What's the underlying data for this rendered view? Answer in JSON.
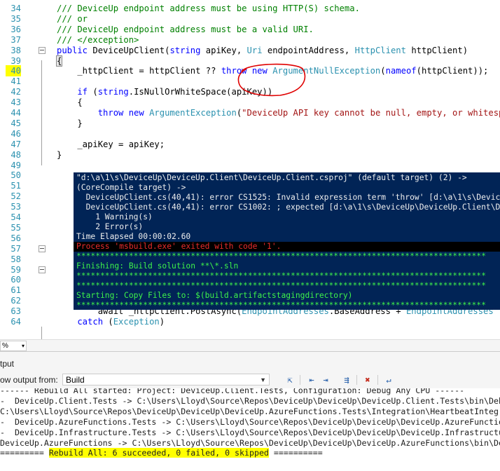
{
  "editor": {
    "lines": [
      {
        "num": "34",
        "tokens": [
          {
            "t": "/// DeviceUp endpoint address must be using HTTP(S) schema.",
            "c": "cm"
          }
        ]
      },
      {
        "num": "35",
        "tokens": [
          {
            "t": "/// or",
            "c": "cm"
          }
        ]
      },
      {
        "num": "36",
        "tokens": [
          {
            "t": "/// DeviceUp endpoint address must be a valid URI.",
            "c": "cm"
          }
        ]
      },
      {
        "num": "37",
        "tokens": [
          {
            "t": "/// </exception>",
            "c": "cm"
          }
        ]
      },
      {
        "num": "38",
        "tokens": [
          {
            "t": "public ",
            "c": "kw"
          },
          {
            "t": "DeviceUpClient(",
            "c": "tx"
          },
          {
            "t": "string",
            "c": "kw"
          },
          {
            "t": " apiKey, ",
            "c": "tx"
          },
          {
            "t": "Uri",
            "c": "ty"
          },
          {
            "t": " endpointAddress, ",
            "c": "tx"
          },
          {
            "t": "HttpClient",
            "c": "ty"
          },
          {
            "t": " httpClient)",
            "c": "tx"
          }
        ]
      },
      {
        "num": "39",
        "tokens": [
          {
            "t": "{",
            "c": "tx"
          }
        ]
      },
      {
        "num": "40",
        "tokens": [
          {
            "t": "    _httpClient = httpClient ?? ",
            "c": "tx"
          },
          {
            "t": "throw new ",
            "c": "kw"
          },
          {
            "t": "ArgumentNullException",
            "c": "ty"
          },
          {
            "t": "(",
            "c": "tx"
          },
          {
            "t": "nameof",
            "c": "kw"
          },
          {
            "t": "(httpClient));",
            "c": "tx"
          }
        ]
      },
      {
        "num": "41",
        "tokens": []
      },
      {
        "num": "42",
        "tokens": [
          {
            "t": "    if ",
            "c": "kw"
          },
          {
            "t": "(",
            "c": "tx"
          },
          {
            "t": "string",
            "c": "kw"
          },
          {
            "t": ".IsNullOrWhiteSpace(apiKey))",
            "c": "tx"
          }
        ]
      },
      {
        "num": "43",
        "tokens": [
          {
            "t": "    {",
            "c": "tx"
          }
        ]
      },
      {
        "num": "44",
        "tokens": [
          {
            "t": "        throw new ",
            "c": "kw"
          },
          {
            "t": "ArgumentException",
            "c": "ty"
          },
          {
            "t": "(",
            "c": "tx"
          },
          {
            "t": "\"DeviceUp API key cannot be null, empty, or whitespace.\"",
            "c": "st"
          }
        ]
      },
      {
        "num": "45",
        "tokens": [
          {
            "t": "    }",
            "c": "tx"
          }
        ]
      },
      {
        "num": "46",
        "tokens": []
      },
      {
        "num": "47",
        "tokens": [
          {
            "t": "    _apiKey = apiKey;",
            "c": "tx"
          }
        ]
      },
      {
        "num": "48",
        "tokens": [
          {
            "t": "}",
            "c": "tx"
          }
        ]
      },
      {
        "num": "49",
        "tokens": []
      },
      {
        "num": "50",
        "tokens": []
      },
      {
        "num": "51",
        "tokens": []
      },
      {
        "num": "52",
        "tokens": []
      },
      {
        "num": "53",
        "tokens": []
      },
      {
        "num": "54",
        "tokens": []
      },
      {
        "num": "55",
        "tokens": []
      },
      {
        "num": "56",
        "tokens": []
      },
      {
        "num": "57",
        "tokens": []
      },
      {
        "num": "58",
        "tokens": []
      },
      {
        "num": "59",
        "tokens": []
      },
      {
        "num": "60",
        "tokens": []
      },
      {
        "num": "61",
        "tokens": []
      },
      {
        "num": "62",
        "tokens": []
      },
      {
        "num": "63",
        "tokens": [
          {
            "t": "        await _httpClient.PostAsync(",
            "c": "tx"
          },
          {
            "t": "EndpointAddresses",
            "c": "ty"
          },
          {
            "t": ".BaseAddress + ",
            "c": "tx"
          },
          {
            "t": "EndpointAddresses",
            "c": "ty"
          }
        ]
      },
      {
        "num": "64",
        "tokens": [
          {
            "t": "    catch ",
            "c": "kw"
          },
          {
            "t": "(",
            "c": "tx"
          },
          {
            "t": "Exception",
            "c": "ty"
          },
          {
            "t": ")",
            "c": "tx"
          }
        ]
      }
    ],
    "highlighted_line": "40"
  },
  "build_log": {
    "lines": [
      {
        "text": "\"d:\\a\\1\\s\\DeviceUp\\DeviceUp.Client\\DeviceUp.Client.csproj\" (default target) (2) ->",
        "style": "normal"
      },
      {
        "text": "(CoreCompile target) ->",
        "style": "normal"
      },
      {
        "text": "  DeviceUpClient.cs(40,41): error CS1525: Invalid expression term 'throw' [d:\\a\\1\\s\\DeviceUp\\DeviceUp",
        "style": "normal"
      },
      {
        "text": "  DeviceUpClient.cs(40,41): error CS1002: ; expected [d:\\a\\1\\s\\DeviceUp\\DeviceUp.Client\\DeviceUp",
        "style": "normal"
      },
      {
        "text": "    1 Warning(s)",
        "style": "normal"
      },
      {
        "text": "    2 Error(s)",
        "style": "normal"
      },
      {
        "text": "Time Elapsed 00:00:02.60",
        "style": "normal"
      },
      {
        "text": "Process 'msbuild.exe' exited with code '1'.",
        "style": "err"
      },
      {
        "text": "**************************************************************************************",
        "style": "grn"
      },
      {
        "text": "Finishing: Build solution **\\*.sln",
        "style": "grn"
      },
      {
        "text": "**************************************************************************************",
        "style": "grn"
      },
      {
        "text": "**************************************************************************************",
        "style": "grn"
      },
      {
        "text": "Starting: Copy Files to: $(build.artifactstagingdirectory)",
        "style": "grn"
      },
      {
        "text": "**************************************************************************************",
        "style": "grn"
      }
    ]
  },
  "zoom": {
    "value": "%"
  },
  "output_panel": {
    "title": "tput",
    "show_output_label": "ow output from:",
    "source": "Build",
    "lines": [
      "------ Rebuild All started: Project: DeviceUp.Client.Tests, Configuration: Debug Any CPU ------",
      "-  DeviceUp.Client.Tests -> C:\\Users\\Lloyd\\Source\\Repos\\DeviceUp\\DeviceUp\\DeviceUp.Client.Tests\\bin\\Deb",
      "C:\\Users\\Lloyd\\Source\\Repos\\DeviceUp\\DeviceUp\\DeviceUp.AzureFunctions.Tests\\Integration\\HeartbeatInteg",
      "-  DeviceUp.AzureFunctions.Tests -> C:\\Users\\Lloyd\\Source\\Repos\\DeviceUp\\DeviceUp\\DeviceUp.AzureFunctio",
      "-  DeviceUp.Infrastructure.Tests -> C:\\Users\\Lloyd\\Source\\Repos\\DeviceUp\\DeviceUp\\DeviceUp.Infrastructu",
      "DeviceUp.AzureFunctions -> C:\\Users\\Lloyd\\Source\\Repos\\DeviceUp\\DeviceUp\\DeviceUp.AzureFunctions\\bin\\De"
    ],
    "summary_prefix": "========= ",
    "summary": "Rebuild All: 6 succeeded, 0 failed, 0 skipped",
    "summary_suffix": " =========="
  },
  "colors": {
    "comment": "#008000",
    "keyword": "#0000ff",
    "type": "#2b91af",
    "string": "#a31515",
    "line_number": "#2b91af",
    "highlight": "#ffff00",
    "build_log_bg": "#012456",
    "build_log_error": "#e82c2c",
    "build_log_green": "#3ef24a",
    "annotation_circle": "#e00000"
  },
  "icons": [
    "collapse-icon",
    "find-message-icon",
    "goto-prev-icon",
    "goto-next-icon",
    "clear-all-icon",
    "word-wrap-icon"
  ]
}
